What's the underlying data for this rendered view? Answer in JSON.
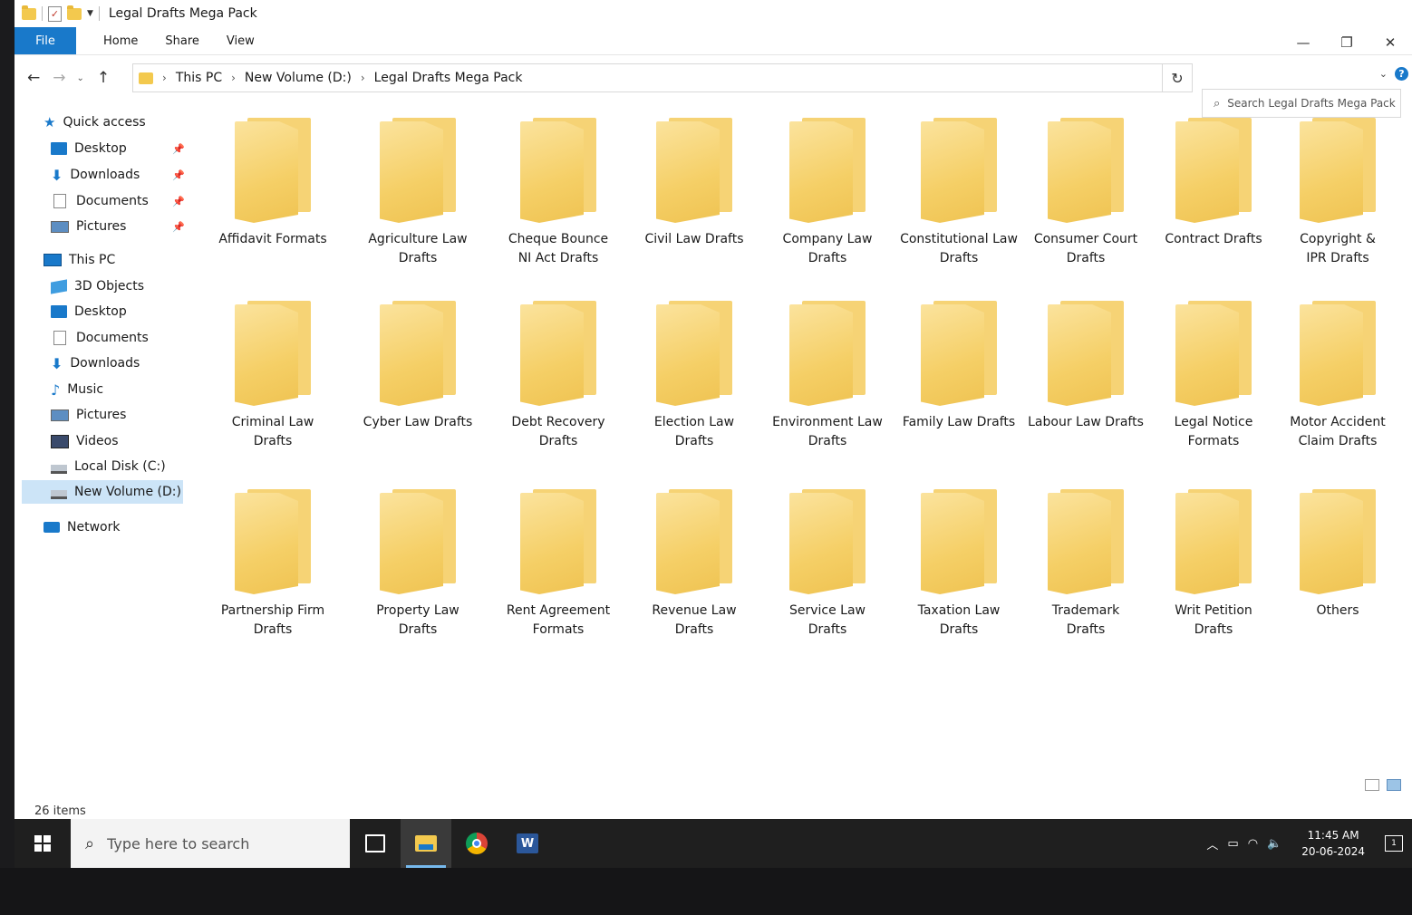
{
  "window": {
    "title": "Legal Drafts Mega Pack"
  },
  "ribbon": {
    "file": "File",
    "home": "Home",
    "share": "Share",
    "view": "View"
  },
  "window_controls": {
    "minimize": "—",
    "restore": "❐",
    "close": "✕"
  },
  "navigation": {
    "back": "←",
    "forward": "→",
    "recent": "⌄",
    "up": "↑",
    "breadcrumb": [
      "This PC",
      "New Volume (D:)",
      "Legal Drafts Mega Pack"
    ],
    "dropdown": "⌄",
    "refresh": "↻"
  },
  "search": {
    "placeholder": "Search Legal Drafts Mega Pack"
  },
  "sidebar": {
    "quick_access": "Quick access",
    "quick_items": [
      {
        "label": "Desktop",
        "icon": "desktop-icon"
      },
      {
        "label": "Downloads",
        "icon": "download-icon"
      },
      {
        "label": "Documents",
        "icon": "document-icon"
      },
      {
        "label": "Pictures",
        "icon": "pictures-icon"
      }
    ],
    "this_pc": "This PC",
    "pc_items": [
      {
        "label": "3D Objects",
        "icon": "3d-objects-icon"
      },
      {
        "label": "Desktop",
        "icon": "desktop-icon"
      },
      {
        "label": "Documents",
        "icon": "document-icon"
      },
      {
        "label": "Downloads",
        "icon": "download-icon"
      },
      {
        "label": "Music",
        "icon": "music-icon"
      },
      {
        "label": "Pictures",
        "icon": "pictures-icon"
      },
      {
        "label": "Videos",
        "icon": "videos-icon"
      },
      {
        "label": "Local Disk (C:)",
        "icon": "disk-icon"
      },
      {
        "label": "New Volume (D:)",
        "icon": "disk-icon"
      }
    ],
    "network": "Network"
  },
  "folders": [
    [
      "Affidavit Formats"
    ],
    [
      "Agriculture Law Drafts"
    ],
    [
      "Cheque Bounce",
      "NI Act Drafts"
    ],
    [
      "Civil Law Drafts"
    ],
    [
      "Company Law",
      "Drafts"
    ],
    [
      "Constitutional Law",
      "Drafts"
    ],
    [
      "Consumer Court",
      "Drafts"
    ],
    [
      "Contract Drafts"
    ],
    [
      "Copyright &",
      "IPR Drafts"
    ],
    [
      "Criminal Law",
      "Drafts"
    ],
    [
      "Cyber Law Drafts"
    ],
    [
      "Debt Recovery",
      "Drafts"
    ],
    [
      "Election Law",
      "Drafts"
    ],
    [
      "Environment Law",
      "Drafts"
    ],
    [
      "Family Law Drafts"
    ],
    [
      "Labour Law Drafts"
    ],
    [
      "Legal Notice",
      "Formats"
    ],
    [
      "Motor Accident",
      "Claim Drafts"
    ],
    [
      "Partnership Firm",
      "Drafts"
    ],
    [
      "Property Law",
      "Drafts"
    ],
    [
      "Rent Agreement",
      "Formats"
    ],
    [
      "Revenue Law",
      "Drafts"
    ],
    [
      "Service Law",
      "Drafts"
    ],
    [
      "Taxation Law",
      "Drafts"
    ],
    [
      "Trademark",
      "Drafts"
    ],
    [
      "Writ Petition",
      "Drafts"
    ],
    [
      "Others"
    ]
  ],
  "status": {
    "items": "26 items"
  },
  "taskbar": {
    "search_placeholder": "Type here to search",
    "time": "11:45 AM",
    "date": "20-06-2024"
  },
  "colors": {
    "accent": "#1979ca",
    "folder": "#f5cf66",
    "taskbar": "#1f1f1f"
  }
}
